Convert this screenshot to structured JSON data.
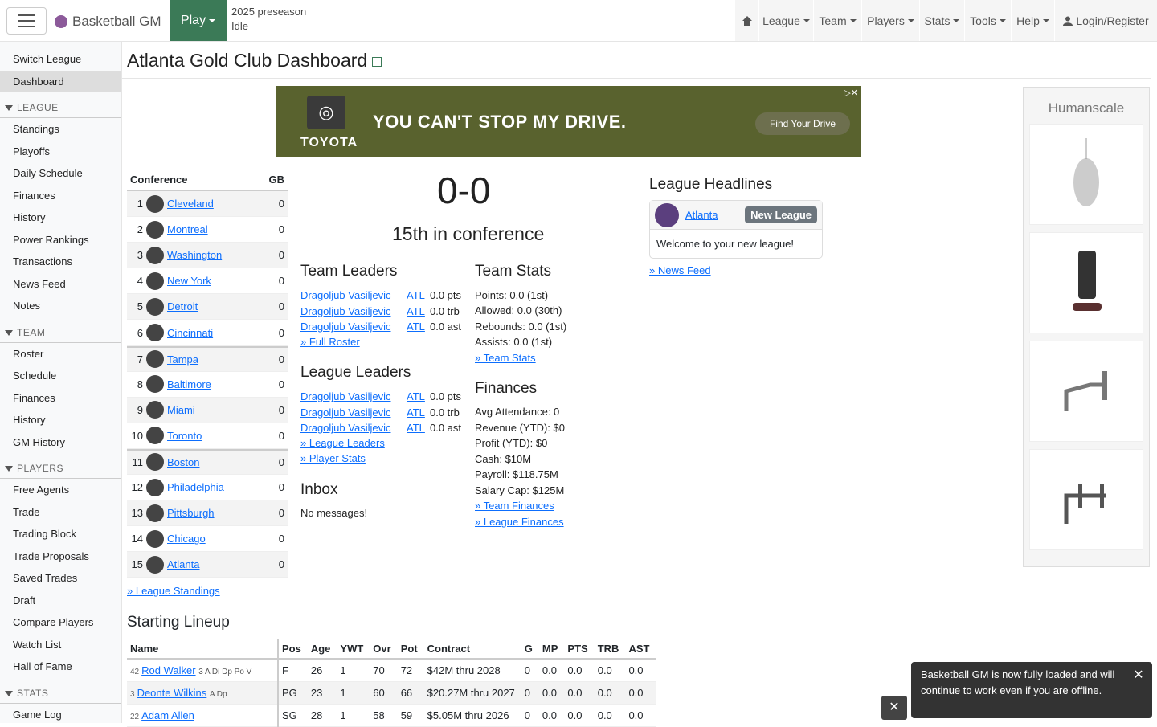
{
  "brand": "Basketball GM",
  "play_label": "Play",
  "status": {
    "phase": "2025 preseason",
    "state": "Idle"
  },
  "nav": [
    "League",
    "Team",
    "Players",
    "Stats",
    "Tools",
    "Help"
  ],
  "login": "Login/Register",
  "sidebar": {
    "top": [
      "Switch League",
      "Dashboard"
    ],
    "league_head": "LEAGUE",
    "league": [
      "Standings",
      "Playoffs",
      "Daily Schedule",
      "Finances",
      "History",
      "Power Rankings",
      "Transactions",
      "News Feed",
      "Notes"
    ],
    "team_head": "TEAM",
    "team": [
      "Roster",
      "Schedule",
      "Finances",
      "History",
      "GM History"
    ],
    "players_head": "PLAYERS",
    "players": [
      "Free Agents",
      "Trade",
      "Trading Block",
      "Trade Proposals",
      "Saved Trades",
      "Draft",
      "Compare Players",
      "Watch List",
      "Hall of Fame"
    ],
    "stats_head": "STATS",
    "stats": [
      "Game Log"
    ]
  },
  "page_title": "Atlanta Gold Club Dashboard",
  "banner": {
    "logo": "TOYOTA",
    "headline": "YOU CAN'T STOP MY DRIVE.",
    "cta": "Find Your Drive"
  },
  "conference": {
    "col1": "Conference",
    "col2": "GB",
    "teams": [
      {
        "rank": "1",
        "name": "Cleveland",
        "gb": "0"
      },
      {
        "rank": "2",
        "name": "Montreal",
        "gb": "0"
      },
      {
        "rank": "3",
        "name": "Washington",
        "gb": "0"
      },
      {
        "rank": "4",
        "name": "New York",
        "gb": "0"
      },
      {
        "rank": "5",
        "name": "Detroit",
        "gb": "0"
      },
      {
        "rank": "6",
        "name": "Cincinnati",
        "gb": "0"
      },
      {
        "rank": "7",
        "name": "Tampa",
        "gb": "0"
      },
      {
        "rank": "8",
        "name": "Baltimore",
        "gb": "0"
      },
      {
        "rank": "9",
        "name": "Miami",
        "gb": "0"
      },
      {
        "rank": "10",
        "name": "Toronto",
        "gb": "0"
      },
      {
        "rank": "11",
        "name": "Boston",
        "gb": "0"
      },
      {
        "rank": "12",
        "name": "Philadelphia",
        "gb": "0"
      },
      {
        "rank": "13",
        "name": "Pittsburgh",
        "gb": "0"
      },
      {
        "rank": "14",
        "name": "Chicago",
        "gb": "0"
      },
      {
        "rank": "15",
        "name": "Atlanta",
        "gb": "0"
      }
    ],
    "link": "» League Standings"
  },
  "record": "0-0",
  "conf_rank": "15th in conference",
  "team_leaders": {
    "title": "Team Leaders",
    "rows": [
      {
        "name": "Dragoljub Vasiljevic",
        "team": "ATL",
        "stat": "0.0 pts"
      },
      {
        "name": "Dragoljub Vasiljevic",
        "team": "ATL",
        "stat": "0.0 trb"
      },
      {
        "name": "Dragoljub Vasiljevic",
        "team": "ATL",
        "stat": "0.0 ast"
      }
    ],
    "link": "» Full Roster"
  },
  "league_leaders": {
    "title": "League Leaders",
    "rows": [
      {
        "name": "Dragoljub Vasiljevic",
        "team": "ATL",
        "stat": "0.0 pts"
      },
      {
        "name": "Dragoljub Vasiljevic",
        "team": "ATL",
        "stat": "0.0 trb"
      },
      {
        "name": "Dragoljub Vasiljevic",
        "team": "ATL",
        "stat": "0.0 ast"
      }
    ],
    "link1": "» League Leaders",
    "link2": "» Player Stats"
  },
  "inbox": {
    "title": "Inbox",
    "msg": "No messages!"
  },
  "team_stats": {
    "title": "Team Stats",
    "lines": [
      "Points: 0.0 (1st)",
      "Allowed: 0.0 (30th)",
      "Rebounds: 0.0 (1st)",
      "Assists: 0.0 (1st)"
    ],
    "link": "» Team Stats"
  },
  "finances": {
    "title": "Finances",
    "lines": [
      "Avg Attendance: 0",
      "Revenue (YTD): $0",
      "Profit (YTD): $0",
      "Cash: $10M",
      "Payroll: $118.75M",
      "Salary Cap: $125M"
    ],
    "link1": "» Team Finances",
    "link2": "» League Finances"
  },
  "headlines": {
    "title": "League Headlines",
    "team": "Atlanta",
    "badge": "New League",
    "msg": "Welcome to your new league!",
    "link": "» News Feed"
  },
  "side_ad": {
    "brand": "Humanscale"
  },
  "lineup": {
    "title": "Starting Lineup",
    "headers": [
      "Name",
      "Pos",
      "Age",
      "YWT",
      "Ovr",
      "Pot",
      "Contract",
      "G",
      "MP",
      "PTS",
      "TRB",
      "AST"
    ],
    "rows": [
      {
        "num": "42",
        "name": "Rod Walker",
        "skills": "3 A Di Dp Po V",
        "pos": "F",
        "age": "26",
        "ywt": "1",
        "ovr": "70",
        "pot": "72",
        "contract": "$42M thru 2028",
        "g": "0",
        "mp": "0.0",
        "pts": "0.0",
        "trb": "0.0",
        "ast": "0.0"
      },
      {
        "num": "3",
        "name": "Deonte Wilkins",
        "skills": "A Dp",
        "pos": "PG",
        "age": "23",
        "ywt": "1",
        "ovr": "60",
        "pot": "66",
        "contract": "$20.27M thru 2027",
        "g": "0",
        "mp": "0.0",
        "pts": "0.0",
        "trb": "0.0",
        "ast": "0.0"
      },
      {
        "num": "22",
        "name": "Adam Allen",
        "skills": "",
        "pos": "SG",
        "age": "28",
        "ywt": "1",
        "ovr": "58",
        "pot": "59",
        "contract": "$5.05M thru 2026",
        "g": "0",
        "mp": "0.0",
        "pts": "0.0",
        "trb": "0.0",
        "ast": "0.0"
      }
    ]
  },
  "toast": "Basketball GM is now fully loaded and will continue to work even if you are offline."
}
